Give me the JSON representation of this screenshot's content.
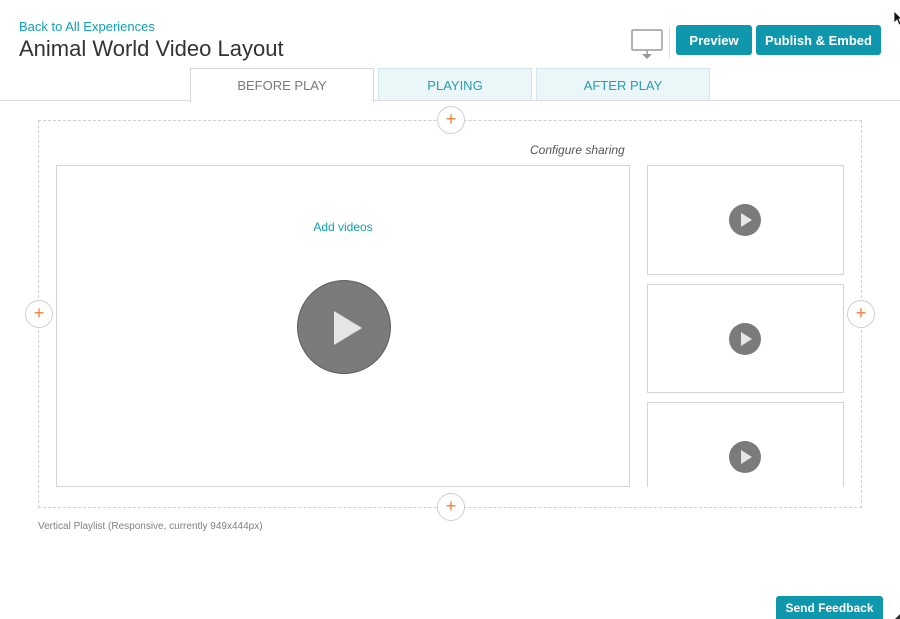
{
  "header": {
    "back_link": "Back to All Experiences",
    "title": "Animal World Video Layout",
    "preview_label": "Preview",
    "publish_label": "Publish & Embed"
  },
  "tabs": [
    {
      "label": "BEFORE PLAY",
      "active": true
    },
    {
      "label": "PLAYING",
      "active": false
    },
    {
      "label": "AFTER PLAY",
      "active": false
    }
  ],
  "canvas": {
    "configure_sharing": "Configure sharing",
    "add_videos": "Add videos",
    "plus_symbol": "+",
    "layout_info": "Vertical Playlist (Responsive, currently 949x444px)"
  },
  "footer": {
    "feedback_label": "Send Feedback"
  },
  "icons": {
    "device_preview": "monitor-icon",
    "add": "plus-icon",
    "play": "play-icon",
    "pointer": "cursor-icon"
  },
  "colors": {
    "accent": "#0f98ad",
    "link": "#0fa0b5",
    "plus": "#ef7f3a",
    "play_button": "#7b7b7b",
    "inactive_tab_bg": "#eaf6f8"
  }
}
